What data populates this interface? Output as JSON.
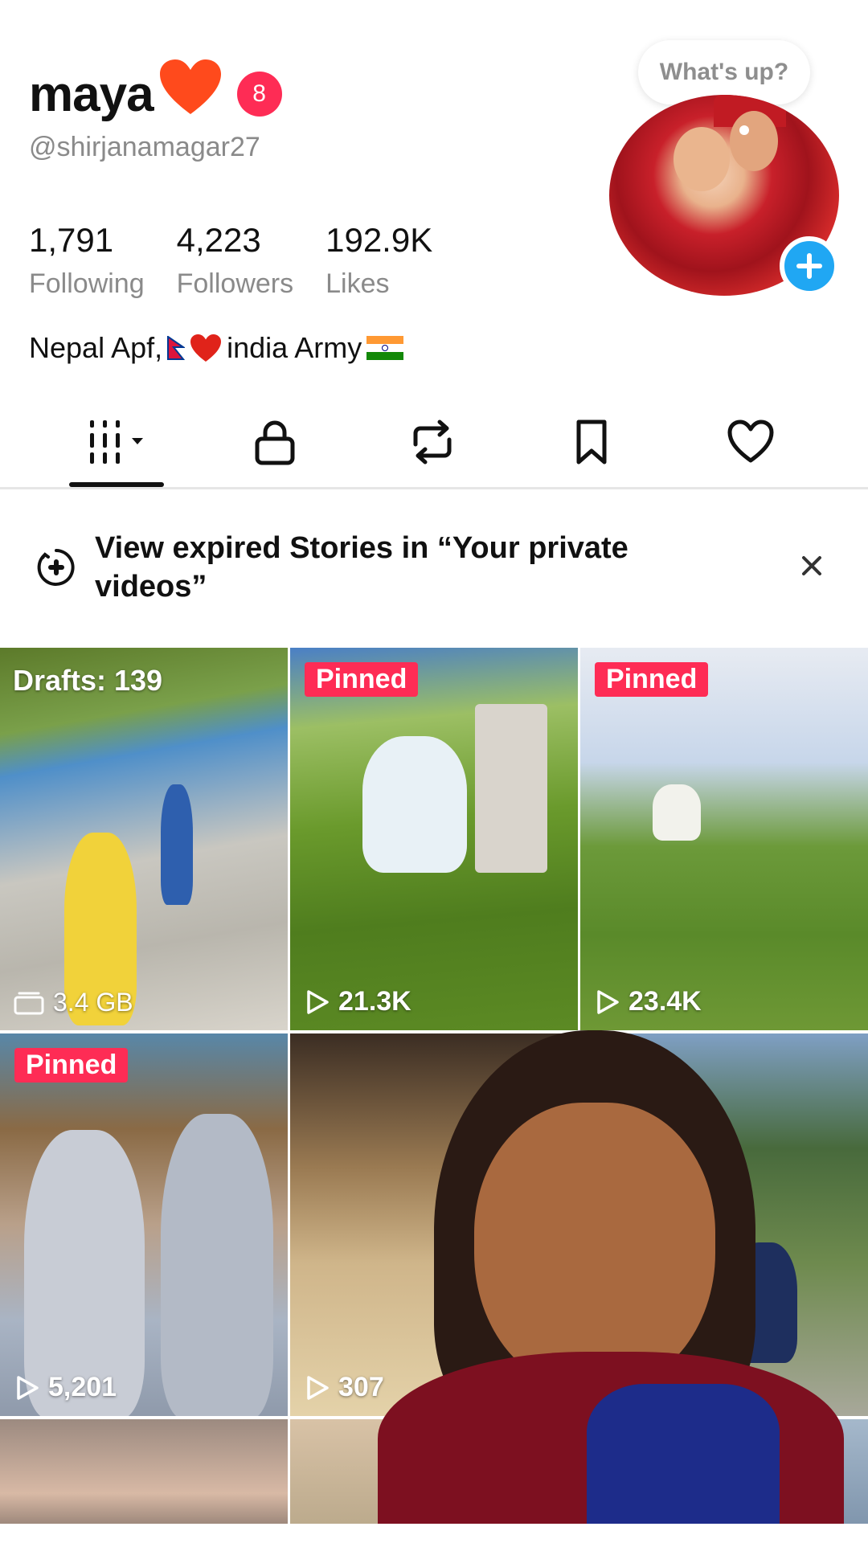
{
  "profile": {
    "name": "maya",
    "name_emoji": "❤️",
    "notification_count": "8",
    "handle": "@shirjanamagar27",
    "status_bubble": "What's up?",
    "stats": [
      {
        "value": "1,791",
        "label": "Following"
      },
      {
        "value": "4,223",
        "label": "Followers"
      },
      {
        "value": "192.9K",
        "label": "Likes"
      }
    ],
    "bio": {
      "part1": "Nepal Apf,",
      "heart": "❤️",
      "part2": "india Army"
    }
  },
  "tabs": [
    {
      "name": "videos-grid",
      "icon": "grid-icon",
      "active": true
    },
    {
      "name": "private",
      "icon": "lock-icon",
      "active": false
    },
    {
      "name": "reposts",
      "icon": "repost-icon",
      "active": false
    },
    {
      "name": "favorites",
      "icon": "bookmark-icon",
      "active": false
    },
    {
      "name": "liked",
      "icon": "heart-icon",
      "active": false
    }
  ],
  "banner": {
    "text": "View expired Stories in “Your private videos”",
    "icon": "story-plus-icon"
  },
  "grid": {
    "drafts_label": "Drafts: 139",
    "drafts_size": "3.4 GB",
    "pinned_label": "Pinned",
    "items": [
      {
        "views": "21.3K",
        "pinned": true
      },
      {
        "views": "23.4K",
        "pinned": true
      },
      {
        "views": "5,201",
        "pinned": true
      },
      {
        "views": "307",
        "pinned": false
      }
    ]
  },
  "colors": {
    "accent": "#fe2c55",
    "plus_button": "#20a7f3",
    "text_muted": "#8a8a8a"
  }
}
